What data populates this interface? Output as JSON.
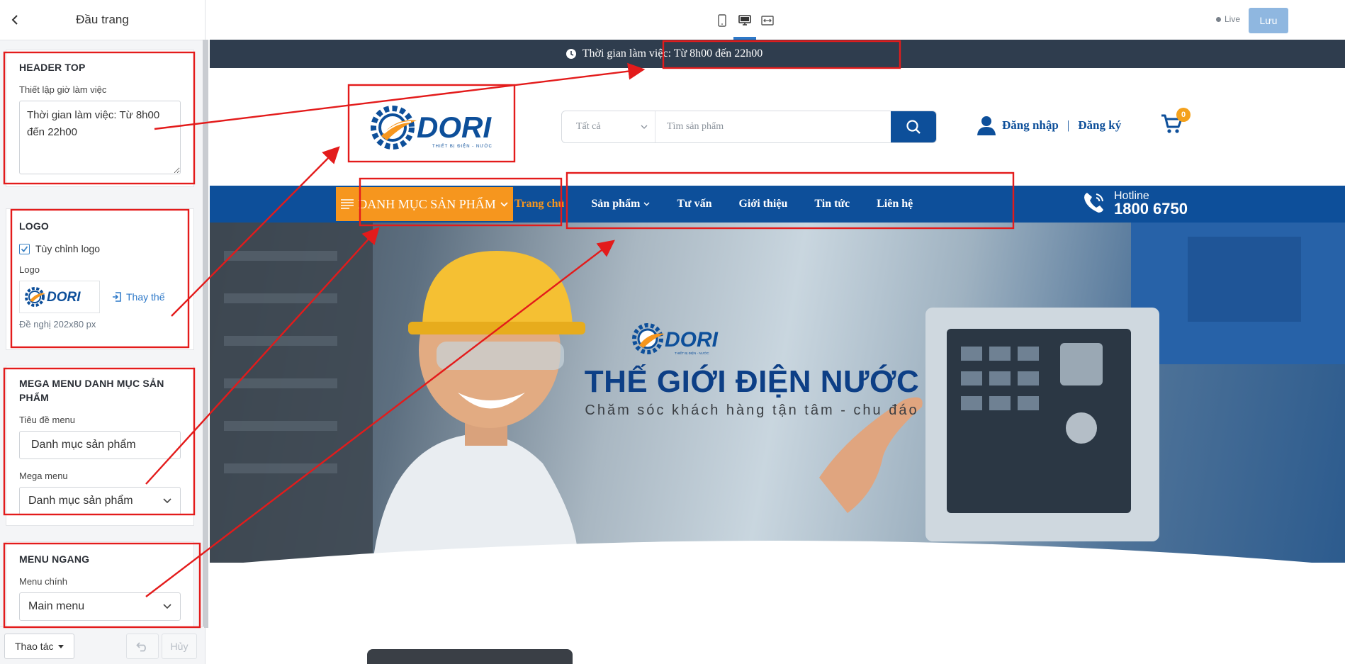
{
  "panel": {
    "title": "Đầu trang",
    "header_top": {
      "title": "HEADER TOP",
      "label": "Thiết lập giờ làm việc",
      "value": "Thời gian làm việc: Từ 8h00 đến 22h00"
    },
    "logo": {
      "title": "LOGO",
      "checkbox_label": "Tùy chỉnh logo",
      "checked": true,
      "label": "Logo",
      "replace_label": "Thay thế",
      "hint": "Đề nghị 202x80 px"
    },
    "mega_menu": {
      "title": "MEGA MENU DANH MỤC SẢN PHẨM",
      "title_label": "Tiêu đề menu",
      "title_value": "Danh mục sản phẩm",
      "menu_label": "Mega menu",
      "menu_value": "Danh mục sản phẩm"
    },
    "menu_ngang": {
      "title": "MENU NGANG",
      "label": "Menu chính",
      "value": "Main menu"
    },
    "footer": {
      "actions_label": "Thao tác",
      "cancel_label": "Hủy"
    }
  },
  "toolbar": {
    "live_label": "Live",
    "save_label": "Lưu",
    "devices": [
      "mobile-icon",
      "desktop-icon",
      "fullwidth-icon"
    ],
    "active_device": "desktop"
  },
  "site": {
    "header_top_text": "Thời gian làm việc: Từ 8h00 đến 22h00",
    "logo_text": "DORI",
    "logo_tagline": "THIẾT BỊ ĐIỆN - NƯỚC",
    "search": {
      "category": "Tất cả",
      "placeholder": "Tìm sản phẩm"
    },
    "account": {
      "login": "Đăng nhập",
      "separator": "|",
      "register": "Đăng ký"
    },
    "cart_count": "0",
    "category_button": "DANH MỤC SẢN PHẨM",
    "nav": [
      {
        "label": "Trang chủ",
        "active": true
      },
      {
        "label": "Sản phẩm",
        "dropdown": true
      },
      {
        "label": "Tư vấn"
      },
      {
        "label": "Giới thiệu"
      },
      {
        "label": "Tin tức"
      },
      {
        "label": "Liên hệ"
      }
    ],
    "hotline": {
      "label": "Hotline",
      "number": "1800 6750"
    },
    "banner": {
      "title": "THẾ GIỚI ĐIỆN NƯỚC",
      "subtitle": "Chăm sóc khách hàng tận tâm - chu đáo"
    }
  },
  "colors": {
    "brand_blue": "#0d4f9a",
    "accent_orange": "#f6961e",
    "header_top_bg": "#2f3d4e",
    "annotation_red": "#e31b1b"
  }
}
